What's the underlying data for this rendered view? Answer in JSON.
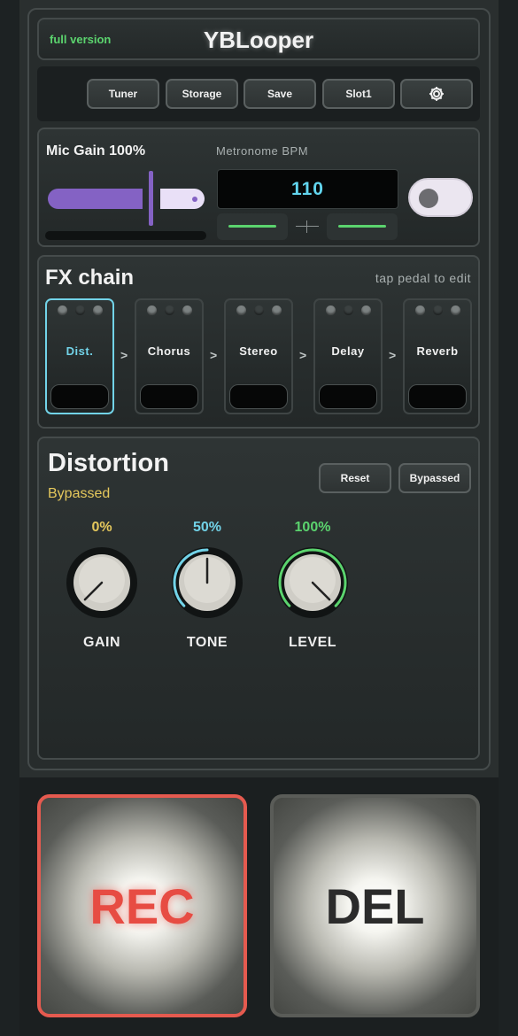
{
  "header": {
    "badge": "full version",
    "title": "YBLooper"
  },
  "toolbar": {
    "buttons": [
      "Tuner",
      "Storage",
      "Save",
      "Slot1"
    ],
    "settings_icon": "gear-icon"
  },
  "mic": {
    "label": "Mic Gain 100%",
    "gain_percent": 100
  },
  "metronome": {
    "label": "Metronome BPM",
    "bpm": "110",
    "enabled": false
  },
  "fx": {
    "title": "FX chain",
    "hint": "tap pedal to edit",
    "pedals": [
      "Dist.",
      "Chorus",
      "Stereo",
      "Delay",
      "Reverb"
    ],
    "arrow": ">",
    "active_index": 0
  },
  "effect": {
    "title": "Distortion",
    "status": "Bypassed",
    "reset_label": "Reset",
    "bypass_label": "Bypassed",
    "knobs": [
      {
        "label": "GAIN",
        "value": "0%",
        "level": 0,
        "color": "#e5c85c"
      },
      {
        "label": "TONE",
        "value": "50%",
        "level": 0.5,
        "color": "#72d3e8"
      },
      {
        "label": "LEVEL",
        "value": "100%",
        "level": 1,
        "color": "#5bd46e"
      }
    ]
  },
  "actions": {
    "rec": "REC",
    "del": "DEL"
  },
  "colors": {
    "accent": "#8462c4",
    "rec": "#e55a4f",
    "active": "#72d3e8"
  }
}
